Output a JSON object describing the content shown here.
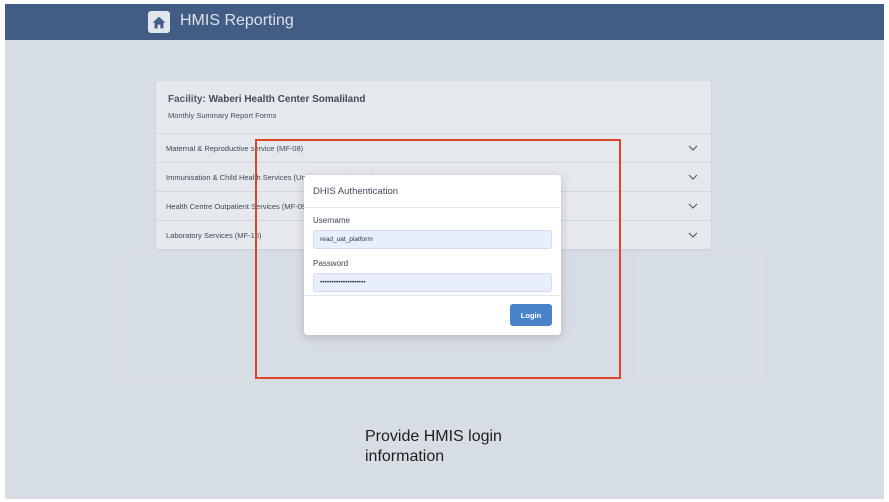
{
  "navbar": {
    "title": "HMIS Reporting",
    "home_icon": "home-icon"
  },
  "card": {
    "facility_label": "Facility:",
    "facility_name": "Waberi Health Center Somaliland",
    "subtitle": "Monthly Summary Report Forms",
    "rows": [
      {
        "label": "Maternal & Reproductive service (MF-08)"
      },
      {
        "label": "Immunisation & Child Health Services (Under 5 & U5s (MF-09)"
      },
      {
        "label": "Health Centre Outpatient Services (MF-09)"
      },
      {
        "label": "Laboratory Services (MF-10)"
      }
    ]
  },
  "modal": {
    "title": "DHIS Authentication",
    "username_label": "Username",
    "username_value": "read_uat_platform",
    "password_label": "Password",
    "password_value": "••••••••••••••••••••",
    "login_label": "Login"
  },
  "caption": {
    "line1": "Provide HMIS login",
    "line2": "information"
  },
  "colors": {
    "navbar": "#3d5a84",
    "accent": "#4a84c8",
    "highlight": "#e0452a"
  }
}
